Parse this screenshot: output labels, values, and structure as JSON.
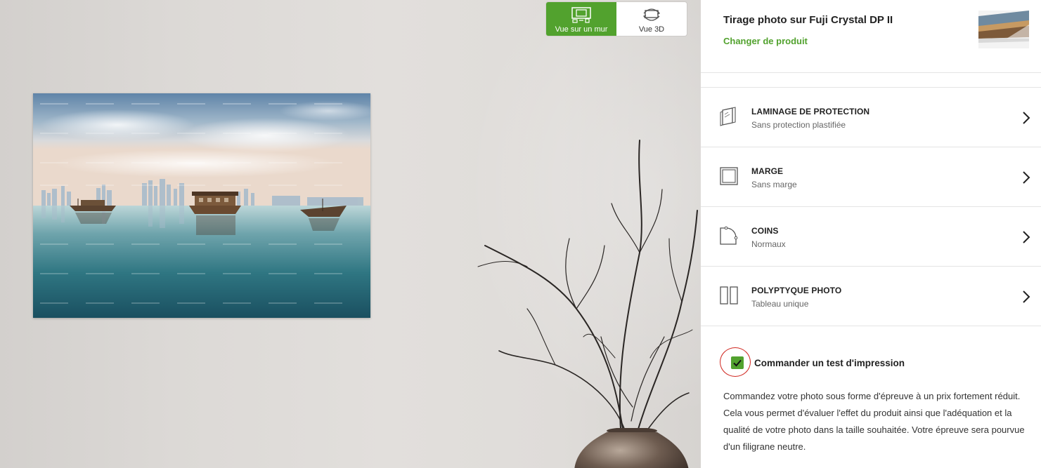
{
  "view_toggle": {
    "wall_label": "Vue sur un mur",
    "view3d_label": "Vue 3D",
    "active": "wall"
  },
  "product": {
    "title": "Tirage photo sur Fuji Crystal DP II",
    "change_label": "Changer de produit"
  },
  "options": [
    {
      "title": "LAMINAGE DE PROTECTION",
      "value": "Sans protection plastifiée",
      "icon": "lamination-icon"
    },
    {
      "title": "MARGE",
      "value": "Sans marge",
      "icon": "margin-icon"
    },
    {
      "title": "COINS",
      "value": "Normaux",
      "icon": "corner-icon"
    },
    {
      "title": "POLYPTYQUE PHOTO",
      "value": "Tableau unique",
      "icon": "polyptych-icon"
    }
  ],
  "test_print": {
    "checked": true,
    "label": "Commander un test d'impression",
    "description": "Commandez votre photo sous forme d'épreuve à un prix fortement réduit. Cela vous permet d'évaluer l'effet du produit ainsi que l'adéquation et la qualité de votre photo dans la taille souhaitée. Votre épreuve sera pourvue d'un filigrane neutre."
  },
  "colors": {
    "accent": "#52a22e",
    "highlight_ring": "#d0261f"
  }
}
